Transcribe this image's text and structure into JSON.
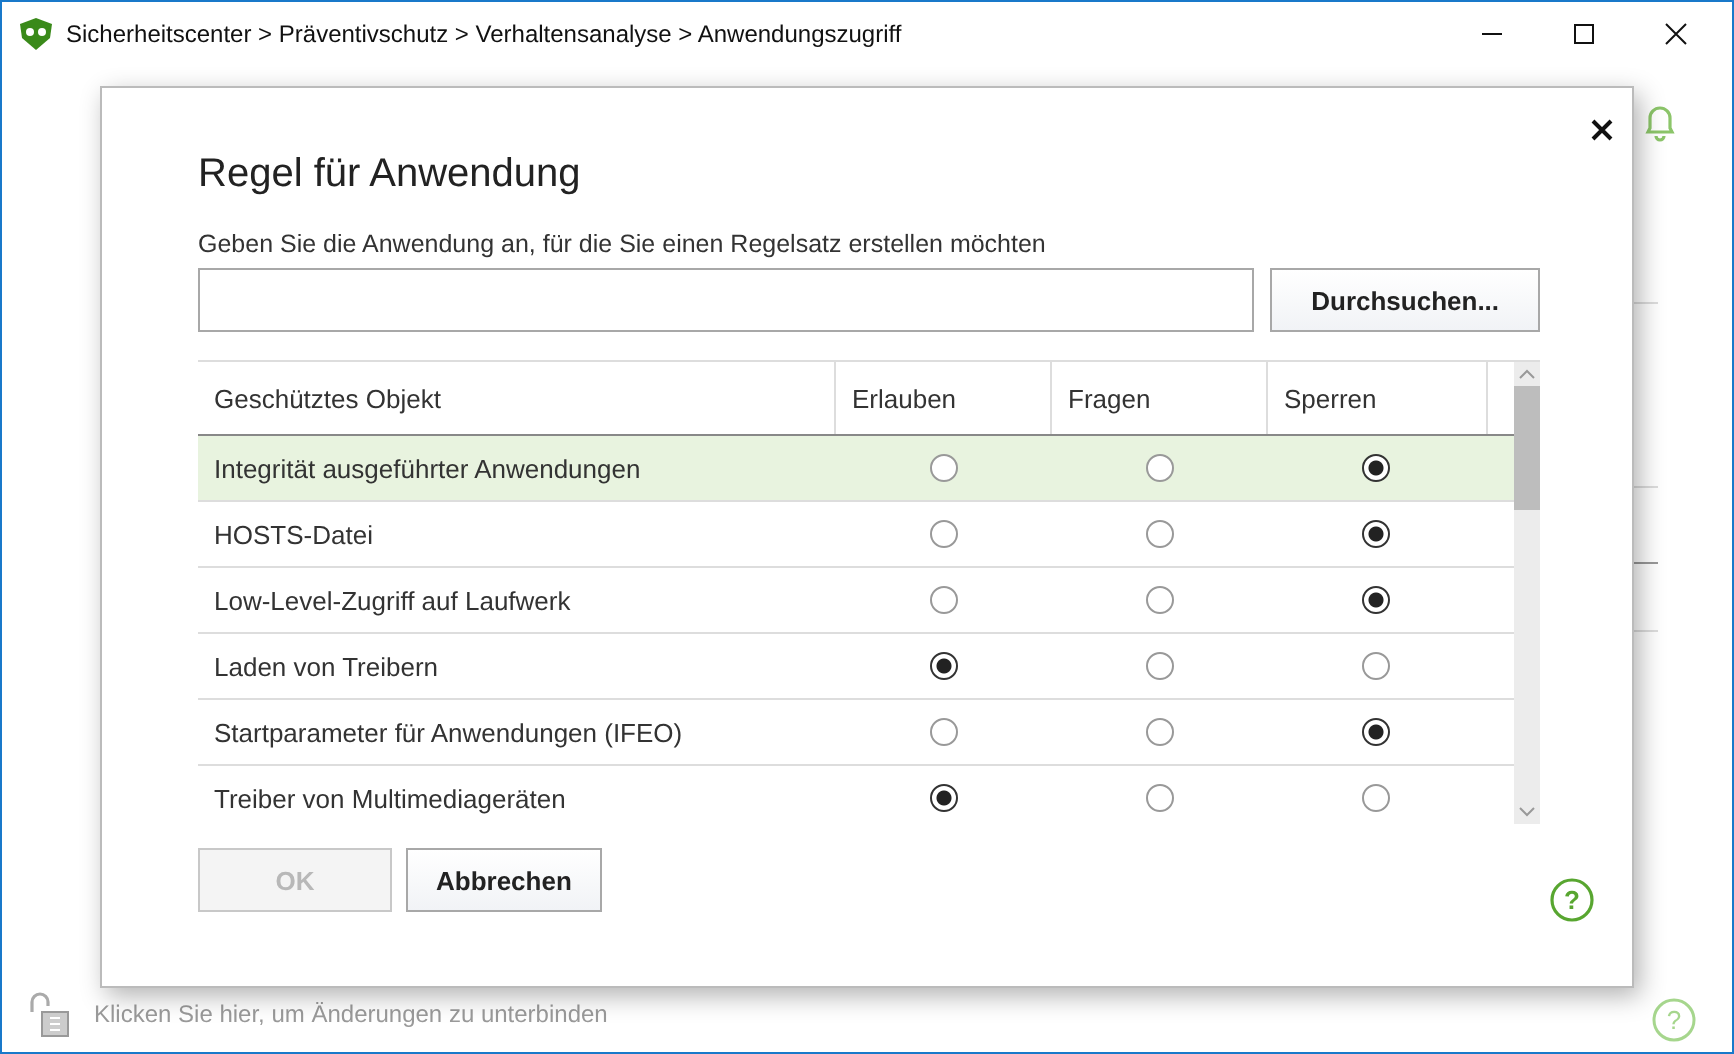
{
  "window": {
    "title": "Sicherheitscenter > Präventivschutz > Verhaltensanalyse > Anwendungszugriff"
  },
  "status_bar": {
    "text": "Klicken Sie hier, um Änderungen zu unterbinden",
    "help_icon": "?"
  },
  "dialog": {
    "title": "Regel für Anwendung",
    "prompt": "Geben Sie die Anwendung an, für die Sie einen Regelsatz erstellen möchten",
    "browse_button": "Durchsuchen...",
    "table": {
      "columns": [
        "Geschütztes Objekt",
        "Erlauben",
        "Fragen",
        "Sperren"
      ],
      "rows": [
        {
          "object": "Integrität ausgeführter Anwendungen",
          "selected": true,
          "options": [
            {
              "selected": false
            },
            {
              "selected": false
            },
            {
              "selected": true
            }
          ]
        },
        {
          "object": "HOSTS-Datei",
          "selected": false,
          "options": [
            {
              "selected": false
            },
            {
              "selected": false
            },
            {
              "selected": true
            }
          ]
        },
        {
          "object": "Low-Level-Zugriff auf Laufwerk",
          "selected": false,
          "options": [
            {
              "selected": false
            },
            {
              "selected": false
            },
            {
              "selected": true
            }
          ]
        },
        {
          "object": "Laden von Treibern",
          "selected": false,
          "options": [
            {
              "selected": true
            },
            {
              "selected": false
            },
            {
              "selected": false
            }
          ]
        },
        {
          "object": "Startparameter für Anwendungen (IFEO)",
          "selected": false,
          "options": [
            {
              "selected": false
            },
            {
              "selected": false
            },
            {
              "selected": true
            }
          ]
        },
        {
          "object": "Treiber von Multimediageräten",
          "selected": false,
          "options": [
            {
              "selected": true
            },
            {
              "selected": false
            },
            {
              "selected": false
            }
          ]
        }
      ]
    },
    "buttons": [
      {
        "label": "OK",
        "disabled": true
      },
      {
        "label": "Abbrechen",
        "disabled": false
      }
    ],
    "help_icon": "?"
  }
}
